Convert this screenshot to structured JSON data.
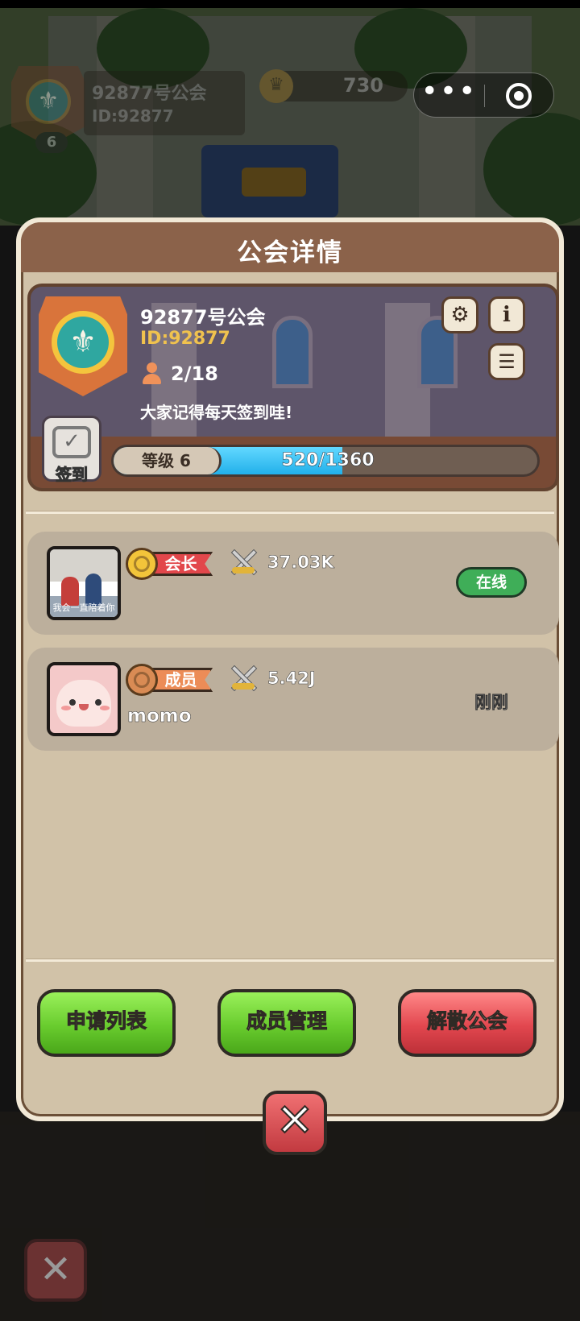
{
  "hud": {
    "guild_name": "92877号公会",
    "guild_id": "ID:92877",
    "guild_level": "6",
    "coins": "730",
    "capsule_more": "•••"
  },
  "dialog": {
    "title": "公会详情",
    "guild": {
      "name": "92877号公会",
      "id": "ID:92877",
      "members": "2/18",
      "notice": "大家记得每天签到哇!",
      "checkin_label": "签到",
      "level_label": "等级 6",
      "exp_text": "520/1360",
      "exp_current": 520,
      "exp_max": 1360
    },
    "members": [
      {
        "rank": "会长",
        "power": "37.03K",
        "name": "",
        "status": "在线",
        "avatar_caption": "我会一直陪着你"
      },
      {
        "rank": "成员",
        "power": "5.42J",
        "name": "momo",
        "status": "刚刚"
      }
    ],
    "buttons": {
      "apply_list": "申请列表",
      "member_manage": "成员管理",
      "disband": "解散公会"
    },
    "close": "✕"
  },
  "lower_close": "✕",
  "colors": {
    "accent_gold": "#f0c24e",
    "exp_bar": "#22b0ea",
    "online": "#3fae58",
    "leader_ribbon": "#e2474b",
    "member_ribbon": "#ec8c57"
  },
  "icons": [
    "fleur-de-lis-emblem-icon",
    "coin-crown-icon",
    "more-dots-icon",
    "target-icon",
    "settings-gear-icon",
    "info-icon",
    "list-icon",
    "member-person-icon",
    "checkin-calendar-icon",
    "gold-medal-icon",
    "bronze-medal-icon",
    "crossed-swords-icon",
    "close-icon"
  ]
}
